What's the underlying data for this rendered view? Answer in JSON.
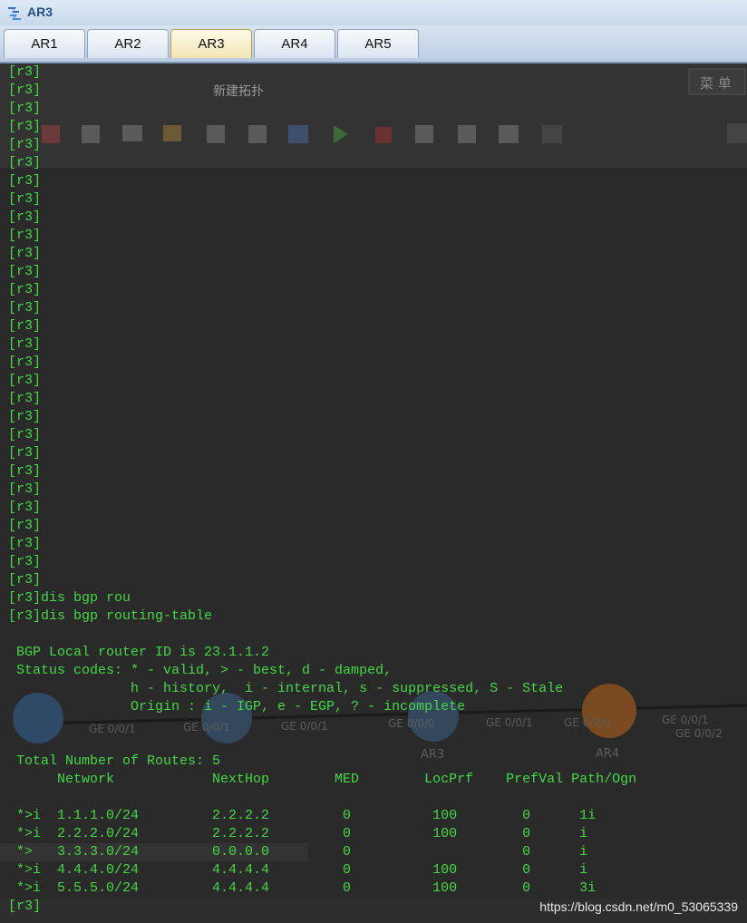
{
  "window": {
    "title": "AR3"
  },
  "tabs": [
    {
      "label": "AR1"
    },
    {
      "label": "AR2"
    },
    {
      "label": "AR3",
      "active": true
    },
    {
      "label": "AR4"
    },
    {
      "label": "AR5"
    }
  ],
  "background": {
    "menu_label": "新建拓扑",
    "menu_button": "菜 单",
    "node_labels": [
      "AR3",
      "AR4"
    ],
    "port_labels": [
      "GE 0/0/1",
      "GE 0/0/1",
      "GE 0/0/1",
      "GE 0/0/0",
      "GE 0/0/1",
      "GE 0/0/0",
      "GE 0/0/1",
      "GE 0/0/2"
    ]
  },
  "terminal": {
    "text_color": "#45d845",
    "lines": [
      "[r3]",
      "[r3]",
      "[r3]",
      "[r3]",
      "[r3]",
      "[r3]",
      "[r3]",
      "[r3]",
      "[r3]",
      "[r3]",
      "[r3]",
      "[r3]",
      "[r3]",
      "[r3]",
      "[r3]",
      "[r3]",
      "[r3]",
      "[r3]",
      "[r3]",
      "[r3]",
      "[r3]",
      "[r3]",
      "[r3]",
      "[r3]",
      "[r3]",
      "[r3]",
      "[r3]",
      "[r3]",
      "[r3]",
      "[r3]dis bgp rou",
      "[r3]dis bgp routing-table",
      "",
      " BGP Local router ID is 23.1.1.2",
      " Status codes: * - valid, > - best, d - damped,",
      "               h - history,  i - internal, s - suppressed, S - Stale",
      "               Origin : i - IGP, e - EGP, ? - incomplete",
      "",
      "",
      " Total Number of Routes: 5",
      "      Network            NextHop        MED        LocPrf    PrefVal Path/Ogn",
      "",
      " *>i  1.1.1.0/24         2.2.2.2         0          100        0      1i",
      " *>i  2.2.2.0/24         2.2.2.2         0          100        0      i",
      " *>   3.3.3.0/24         0.0.0.0         0                     0      i",
      " *>i  4.4.4.0/24         4.4.4.4         0          100        0      i",
      " *>i  5.5.5.0/24         4.4.4.4         0          100        0      3i",
      "[r3]"
    ]
  },
  "watermark": "https://blog.csdn.net/m0_53065339"
}
